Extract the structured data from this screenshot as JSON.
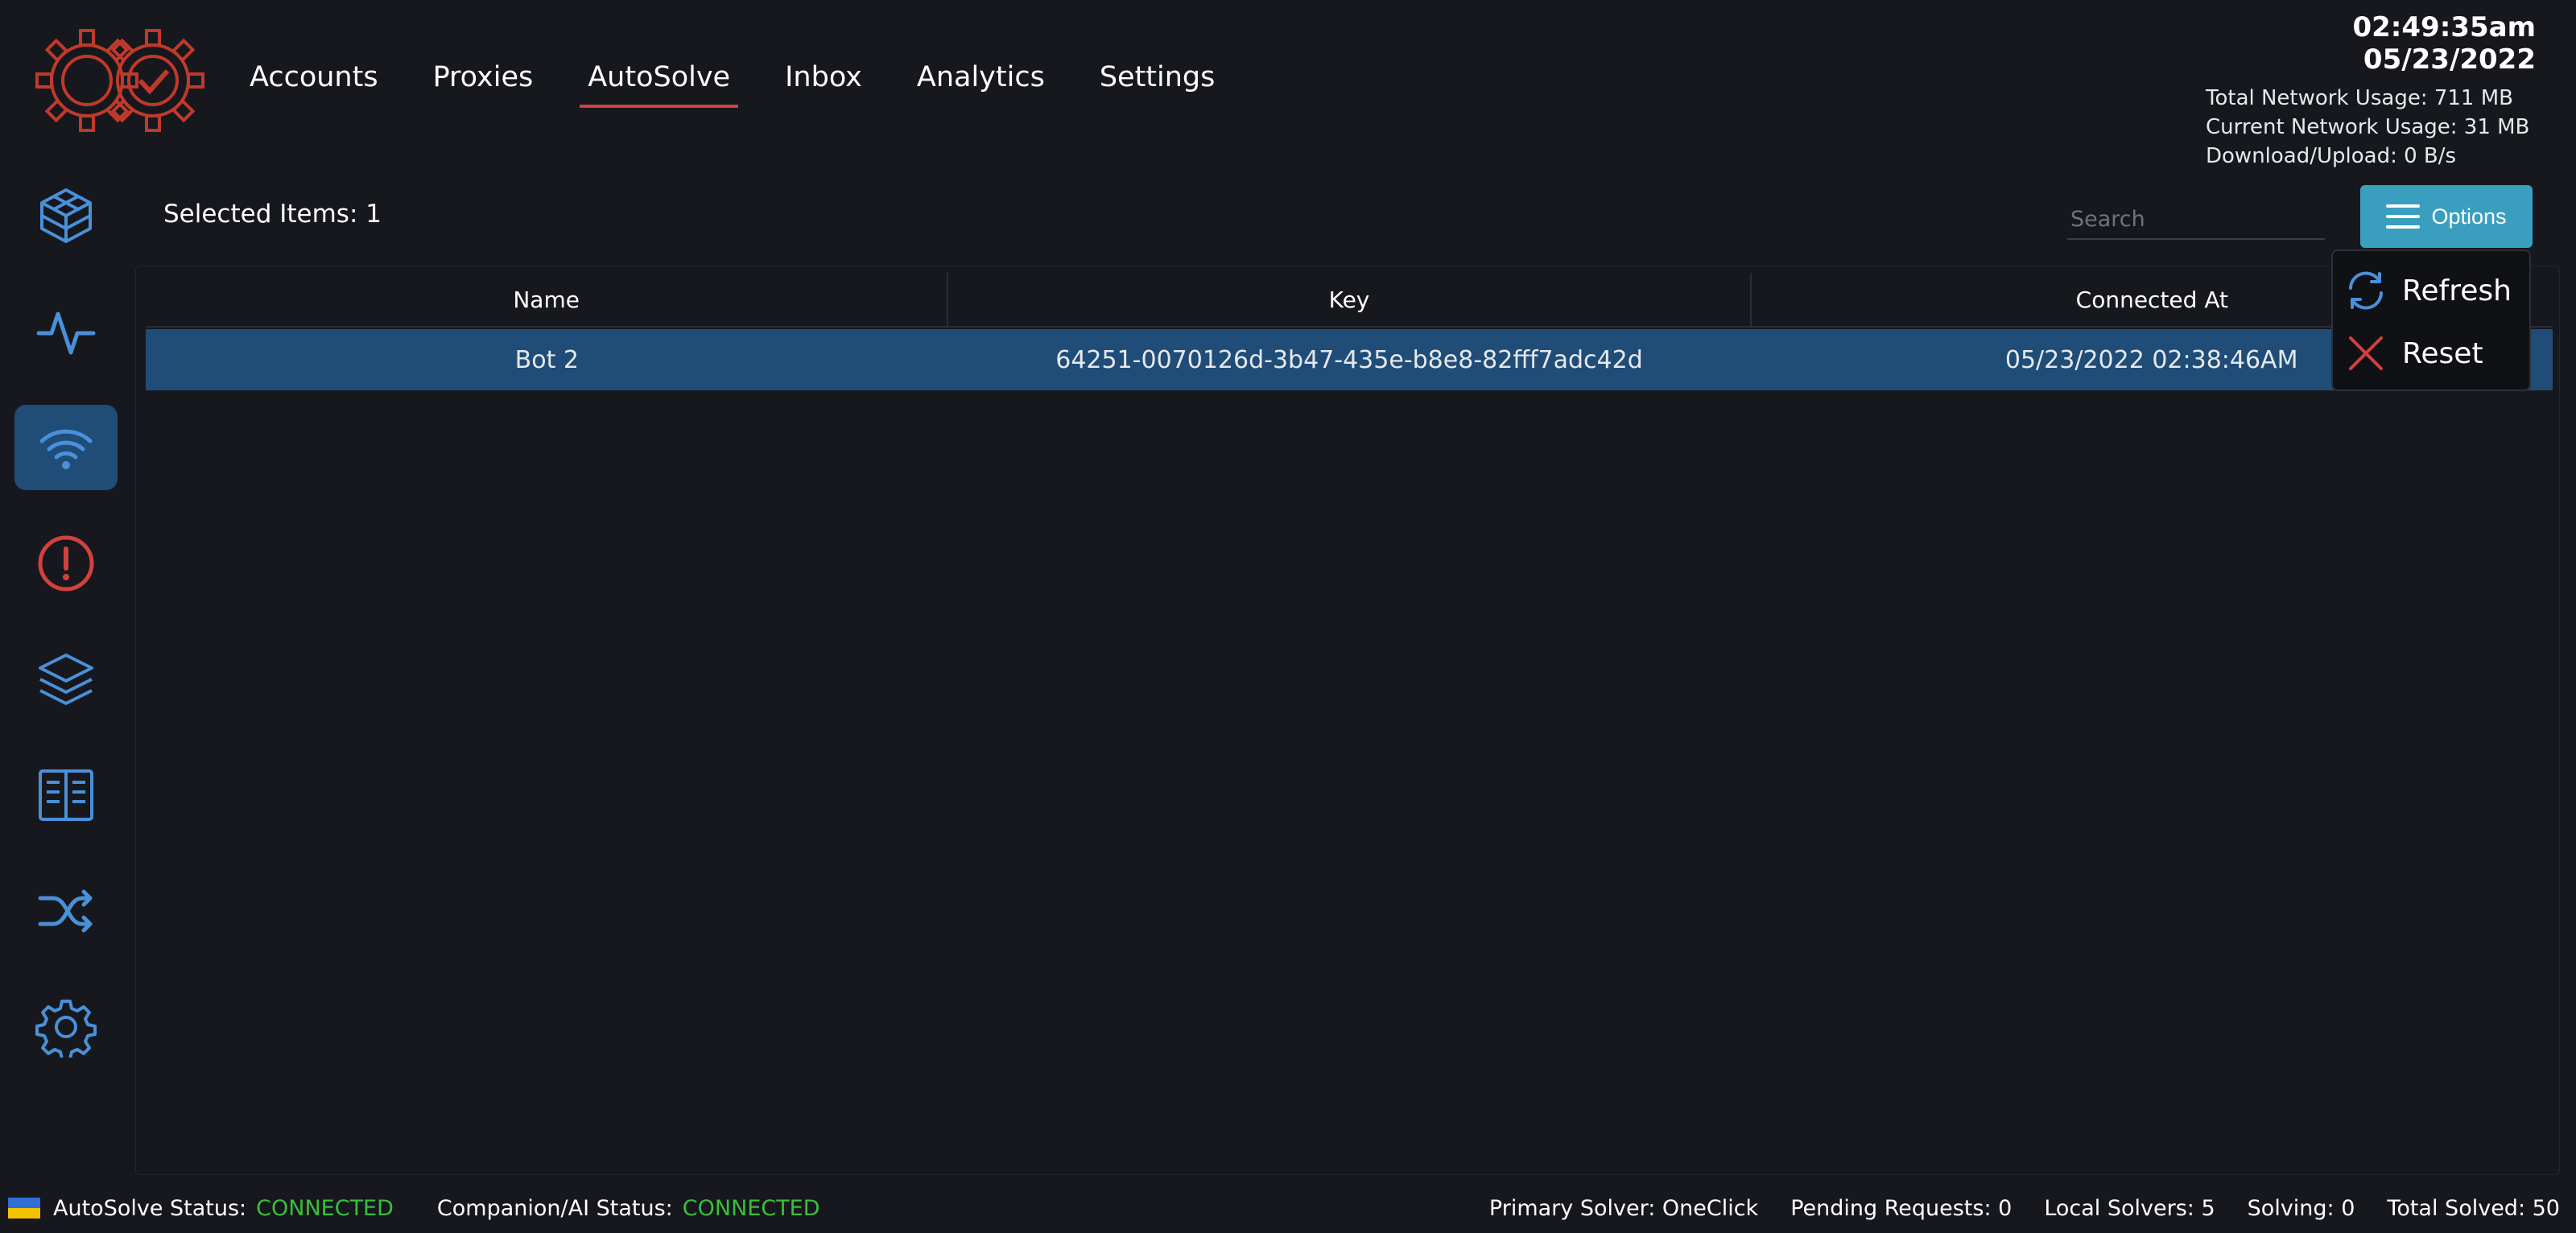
{
  "app": {
    "logo_name": "gear-check-logo"
  },
  "nav": {
    "tabs": [
      {
        "label": "Accounts"
      },
      {
        "label": "Proxies"
      },
      {
        "label": "AutoSolve",
        "active": true
      },
      {
        "label": "Inbox"
      },
      {
        "label": "Analytics"
      },
      {
        "label": "Settings"
      }
    ]
  },
  "header_stats": {
    "clock": "02:49:35am 05/23/2022",
    "total_network": "Total Network Usage:  711 MB",
    "current_network": "Current Network Usage: 31 MB",
    "download_upload": "Download/Upload: 0 B/s"
  },
  "sidebar": {
    "items": [
      {
        "icon": "cube-icon"
      },
      {
        "icon": "pulse-icon"
      },
      {
        "icon": "wifi-icon",
        "active": true
      },
      {
        "icon": "alert-icon"
      },
      {
        "icon": "layers-icon"
      },
      {
        "icon": "list-icon"
      },
      {
        "icon": "shuffle-icon"
      },
      {
        "icon": "gear-icon"
      }
    ]
  },
  "toolbar": {
    "selected_items": "Selected Items: 1",
    "search_placeholder": "Search",
    "options_label": "Options"
  },
  "options_menu": {
    "refresh_label": "Refresh",
    "reset_label": "Reset"
  },
  "table": {
    "columns": [
      "Name",
      "Key",
      "Connected At"
    ],
    "rows": [
      {
        "name": "Bot 2",
        "key": "64251-0070126d-3b47-435e-b8e8-82fff7adc42d",
        "connected_at": "05/23/2022 02:38:46AM"
      }
    ]
  },
  "statusbar": {
    "autosolve_label": "AutoSolve Status:",
    "autosolve_value": "CONNECTED",
    "companion_label": "Companion/AI Status:",
    "companion_value": "CONNECTED",
    "primary_solver": "Primary Solver: OneClick",
    "pending_requests": "Pending Requests: 0",
    "local_solvers": "Local Solvers: 5",
    "solving": "Solving: 0",
    "total_solved": "Total Solved: 50"
  },
  "colors": {
    "accent_blue": "#3a9fbf",
    "active_row": "#1f4d78",
    "connected_green": "#3bbf3b",
    "brand_red": "#d2413f",
    "icon_blue": "#4a90d9"
  }
}
